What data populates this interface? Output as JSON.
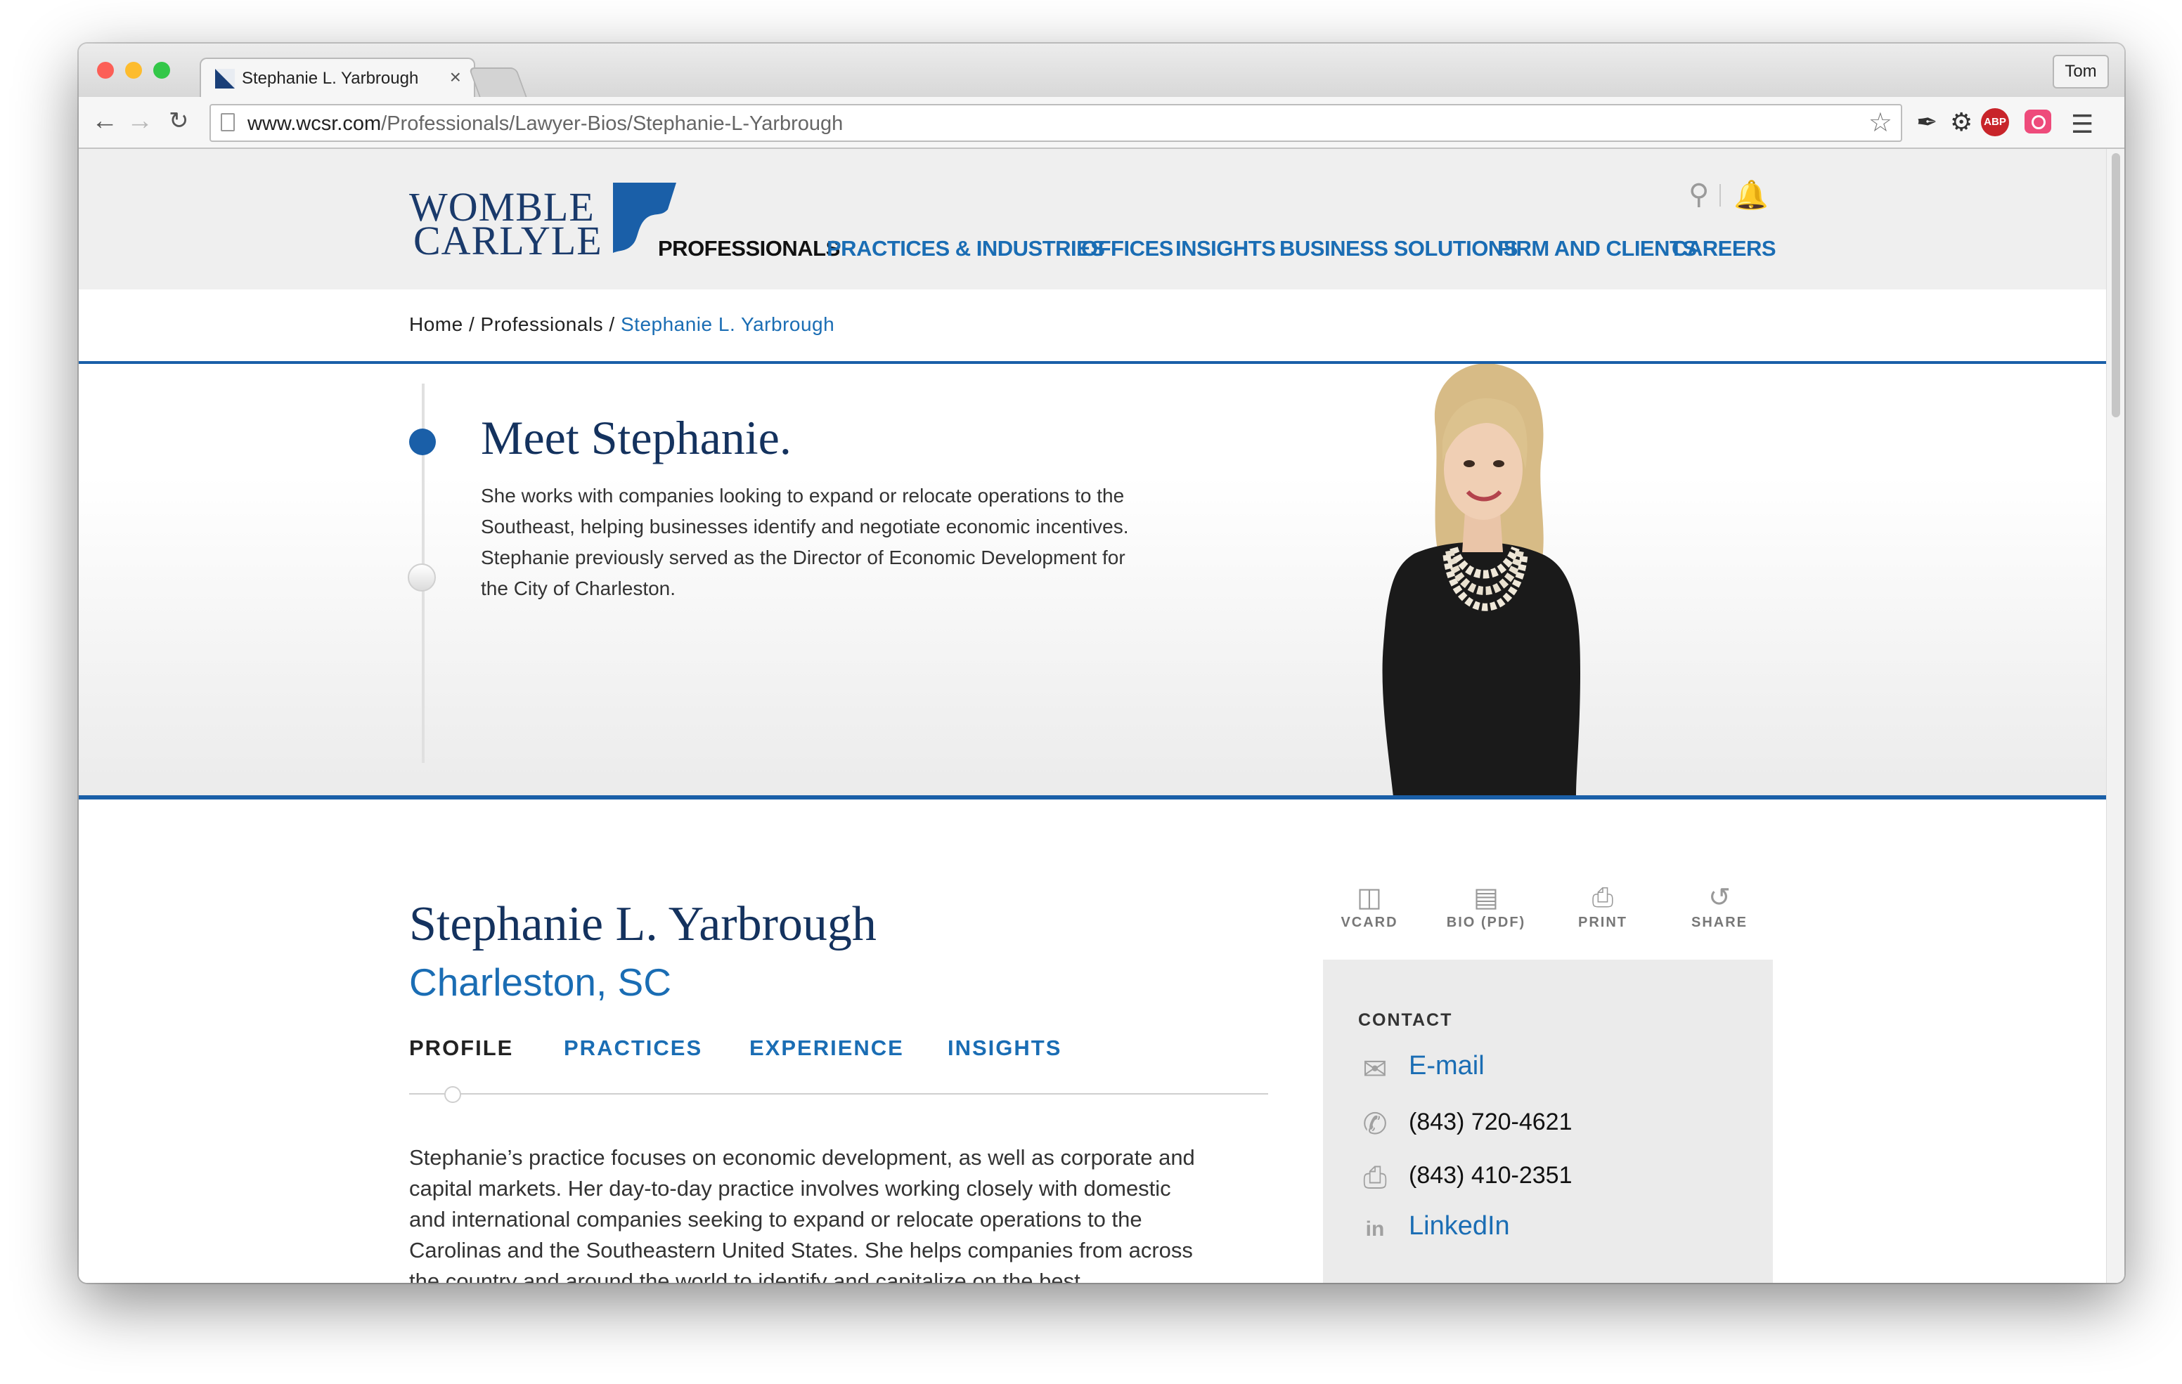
{
  "browser": {
    "tab_title": "Stephanie L. Yarbrough",
    "tab_close": "×",
    "user_label": "Tom",
    "url_host": "www.wcsr.com",
    "url_path": "/Professionals/Lawyer-Bios/Stephanie-L-Yarbrough",
    "abp_badge": "ABP",
    "icons": [
      "back-arrow-icon",
      "forward-arrow-icon",
      "reload-icon",
      "bookmark-star-icon",
      "eyedropper-icon",
      "gear-icon",
      "adblock-icon",
      "screenshot-camera-icon",
      "menu-icon"
    ]
  },
  "site": {
    "logo_line1": "WOMBLE",
    "logo_line2": "CARLYLE",
    "logo_color": "#1a3a6b",
    "nav": [
      "PROFESSIONALS",
      "PRACTICES & INDUSTRIES",
      "OFFICES",
      "INSIGHTS",
      "BUSINESS SOLUTIONS",
      "FIRM AND CLIENTS",
      "CAREERS"
    ],
    "nav_active_index": 0,
    "accent": "#1a6db4",
    "rule_color": "#1a5fa8"
  },
  "breadcrumb": {
    "home": "Home",
    "sep1": " / ",
    "section": "Professionals",
    "sep2": " / ",
    "current": "Stephanie L. Yarbrough"
  },
  "hero": {
    "heading": "Meet Stephanie.",
    "text": "She works with companies looking to expand or relocate operations to the Southeast, helping businesses identify and negotiate economic incentives. Stephanie previously served as the Director of Economic Development for the City of Charleston."
  },
  "profile": {
    "name": "Stephanie L. Yarbrough",
    "location": "Charleston, SC",
    "tabs": [
      "PROFILE",
      "PRACTICES",
      "EXPERIENCE",
      "INSIGHTS"
    ],
    "body": "Stephanie’s practice focuses on economic development, as well as corporate and capital markets. Her day-to-day practice involves working closely with domestic and international companies seeking to expand or relocate operations to the Carolinas and the Southeastern United States. She helps companies from across the country and around the world to identify and capitalize on the best opportunities in the Southeastern United"
  },
  "actions": [
    "VCARD",
    "BIO (PDF)",
    "PRINT",
    "SHARE"
  ],
  "contact": {
    "heading": "CONTACT",
    "email": "E-mail",
    "phone": "(843) 720-4621",
    "fax": "(843) 410-2351",
    "linkedin": "LinkedIn"
  }
}
